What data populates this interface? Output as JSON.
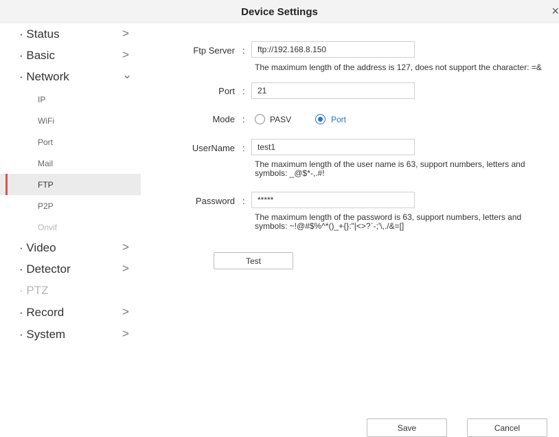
{
  "window": {
    "title": "Device Settings",
    "close_glyph": "×"
  },
  "sidebar": {
    "items": [
      {
        "label": "· Status",
        "chevron": ">"
      },
      {
        "label": "· Basic",
        "chevron": ">"
      },
      {
        "label": "· Network",
        "chevron": "⌄"
      },
      {
        "label": "IP"
      },
      {
        "label": "WiFi"
      },
      {
        "label": "Port"
      },
      {
        "label": "Mail"
      },
      {
        "label": "FTP"
      },
      {
        "label": "P2P"
      },
      {
        "label": "Onvif"
      },
      {
        "label": "· Video",
        "chevron": ">"
      },
      {
        "label": "· Detector",
        "chevron": ">"
      },
      {
        "label": "· PTZ"
      },
      {
        "label": "· Record",
        "chevron": ">"
      },
      {
        "label": "· System",
        "chevron": ">"
      }
    ]
  },
  "form": {
    "colon": ":",
    "ftp_server": {
      "label": "Ftp Server",
      "value": "ftp://192.168.8.150",
      "hint": "The maximum length of the address is 127, does not support the character: =&"
    },
    "port": {
      "label": "Port",
      "value": "21"
    },
    "mode": {
      "label": "Mode",
      "options": [
        "PASV",
        "Port"
      ],
      "selected": "Port"
    },
    "username": {
      "label": "UserName",
      "value": "test1",
      "hint_line1": "The maximum length of the user name is 63, support numbers, letters and",
      "hint_line2": "symbols: _@$*-,.#!"
    },
    "password": {
      "label": "Password",
      "value": "*****",
      "hint_line1": "The maximum length of the password is 63, support numbers, letters and",
      "hint_line2": "symbols: ~!@#$%^*()_+{}:\"|<>?`-;'\\,./&=[]"
    },
    "test_button": "Test"
  },
  "footer": {
    "save": "Save",
    "cancel": "Cancel"
  },
  "colors": {
    "accent": "#2a6fd6",
    "active_marker": "#d9534f"
  }
}
